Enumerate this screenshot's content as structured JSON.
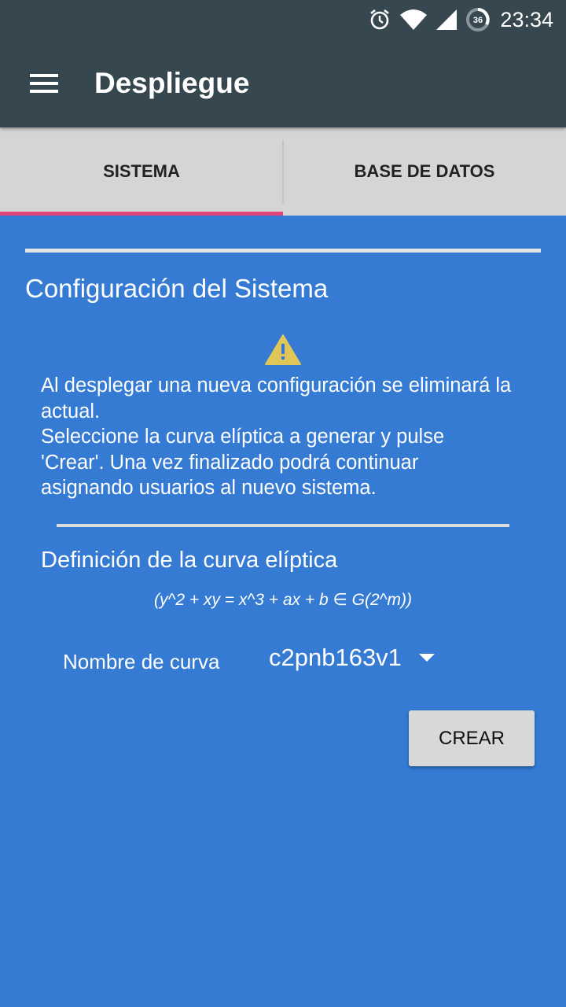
{
  "status_bar": {
    "icons": [
      "alarm-icon",
      "wifi-icon",
      "signal-icon",
      "battery-icon"
    ],
    "battery_level": "36",
    "time": "23:34"
  },
  "app_bar": {
    "menu_icon": "hamburger-menu-icon",
    "title": "Despliegue"
  },
  "tabs": [
    {
      "label": "SISTEMA",
      "active": true
    },
    {
      "label": "BASE DE DATOS",
      "active": false
    }
  ],
  "main": {
    "section_title": "Configuración del Sistema",
    "warning_icon": "warning-triangle-icon",
    "info_lines": [
      "Al desplegar una nueva configuración se eliminará la actual.",
      "Seleccione la curva elíptica a generar y pulse 'Crear'. Una vez finalizado podrá continuar asignando usuarios al nuevo sistema."
    ],
    "curve_section_title": "Definición de la curva elíptica",
    "formula": "(y^2 + xy = x^3 + ax + b  ∈ G(2^m))",
    "curve_name_label": "Nombre de curva",
    "curve_name_value": "c2pnb163v1",
    "create_button": "CREAR"
  },
  "colors": {
    "app_bar": "#37474f",
    "tab_bar": "#d5d5d5",
    "tab_indicator": "#e2457b",
    "background": "#357bd4",
    "warning": "#e0c558"
  }
}
